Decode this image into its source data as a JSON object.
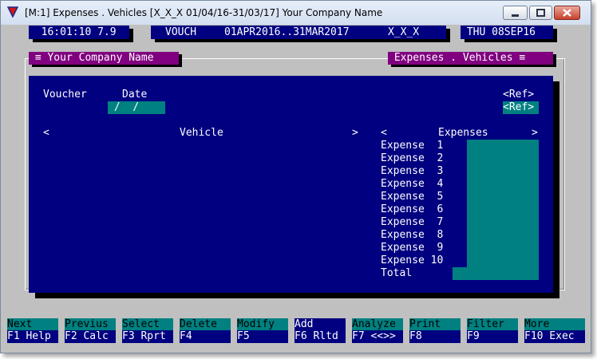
{
  "window": {
    "title": "[M:1]  Expenses . Vehicles  [X_X_X  01/04/16-31/03/17]  Your Company Name"
  },
  "status": {
    "time": "16:01:10 7.9",
    "mode": "VOUCH",
    "period": "01APR2016..31MAR2017",
    "user": "X_X_X",
    "date": "THU 08SEP16"
  },
  "form": {
    "left_caption": "≡ Your Company Name",
    "right_caption": "Expenses . Vehicles ≡",
    "voucher_label": "Voucher",
    "date_label": "Date",
    "date_value": " /  /",
    "ref_label": "<Ref>",
    "ref_button": "<Ref>",
    "vehicle_prev": "<",
    "vehicle_header": "Vehicle",
    "vehicle_next": ">",
    "expenses_prev": "<",
    "expenses_header": "Expenses",
    "expenses_next": ">",
    "expense_rows": [
      "Expense  1",
      "Expense  2",
      "Expense  3",
      "Expense  4",
      "Expense  5",
      "Expense  6",
      "Expense  7",
      "Expense  8",
      "Expense  9",
      "Expense 10"
    ],
    "total_label": "Total"
  },
  "fkeys": [
    {
      "action": "Next",
      "key": "F1 Help"
    },
    {
      "action": "Previus",
      "key": "F2 Calc"
    },
    {
      "action": "Select",
      "key": "F3 Rprt"
    },
    {
      "action": "Delete",
      "key": "F4"
    },
    {
      "action": "Modify",
      "key": "F5"
    },
    {
      "action": "Add",
      "key": "F6 Rltd"
    },
    {
      "action": "Analyze",
      "key": "F7 <<>>"
    },
    {
      "action": "Print",
      "key": "F8"
    },
    {
      "action": "Filter",
      "key": "F9"
    },
    {
      "action": "More",
      "key": "F10 Exec"
    }
  ],
  "colors": {
    "screen": "#c0c0c0",
    "panel": "#000080",
    "field": "#008080",
    "caption": "#800080"
  }
}
